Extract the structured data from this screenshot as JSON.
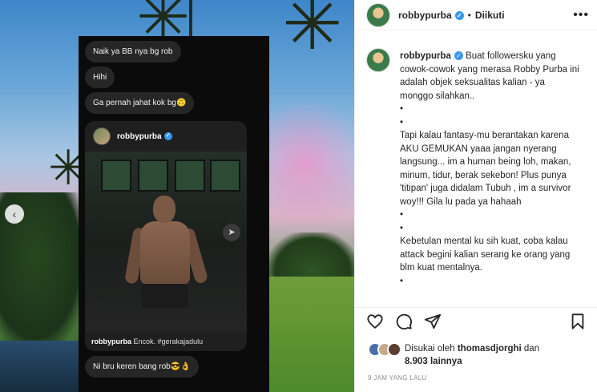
{
  "chat": {
    "messages": [
      "Naik ya BB nya bg rob",
      "Hihi",
      "Ga pernah jahat kok bg🙃"
    ],
    "shared_post": {
      "username": "robbypurba",
      "caption_user": "robbypurba",
      "caption_text": "Encok. #gerakajadulu"
    },
    "reply": "Ni bru keren bang rob😎👌"
  },
  "header": {
    "username": "robbypurba",
    "separator": "•",
    "follow_status": "Diikuti",
    "more": "•••"
  },
  "caption": {
    "username": "robbypurba",
    "intro": "Buat followersku yang cowok-cowok yang merasa Robby Purba ini adalah objek seksualitas kalian - ya monggo silahkan..",
    "para2": "Tapi kalau fantasy-mu berantakan karena AKU GEMUKAN yaaa jangan nyerang langsung... im a human being loh, makan, minum, tidur, berak sekebon! Plus punya 'titipan' juga didalam Tubuh , im a survivor woy!!! Gila lu pada ya hahaah",
    "para3": "Kebetulan mental ku sih kuat, coba kalau attack begini kalian serang ke orang yang blm kuat mentalnya.",
    "bullet": "•"
  },
  "likes": {
    "prefix": "Disukai oleh ",
    "user": "thomasdjorghi",
    "middle": " dan",
    "count": "8.903 lainnya"
  },
  "time": "9 JAM YANG LALU",
  "colors": {
    "verified": "#3897f0",
    "text": "#262626",
    "muted": "#8e8e8e",
    "chat_bg": "#0b0b0b",
    "bubble": "#262626"
  }
}
